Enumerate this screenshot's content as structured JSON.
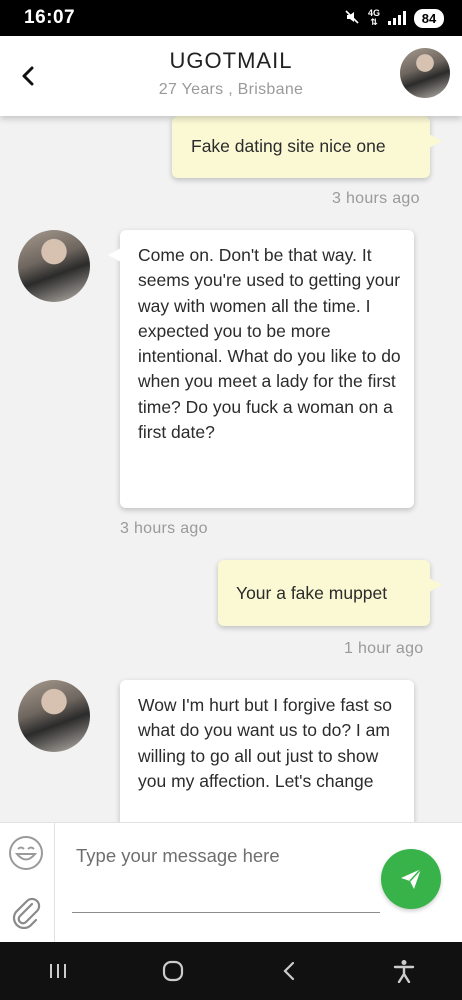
{
  "status_bar": {
    "time": "16:07",
    "network": "4G",
    "battery": "84"
  },
  "header": {
    "title": "UGOTMAIL",
    "subtitle": "27 Years , Brisbane"
  },
  "messages": [
    {
      "direction": "out",
      "text": "Fake dating site nice one",
      "time": "3 hours ago"
    },
    {
      "direction": "in",
      "text": "Come on. Don't be that way. It seems you're used to getting your way with women all the time. I expected you to be more intentional. What do you like to do when you meet a lady for the first time? Do you fuck a woman on a first date?",
      "time": "3 hours ago"
    },
    {
      "direction": "out",
      "text": "Your a fake muppet",
      "time": "1 hour ago"
    },
    {
      "direction": "in",
      "text": "Wow I'm hurt but I forgive fast so what do you want us to do? I am willing to go all out just to show you my affection. Let's change"
    }
  ],
  "composer": {
    "placeholder": "Type your message here"
  },
  "colors": {
    "send_button": "#37b34a",
    "outgoing_bubble": "#fbf9d4",
    "incoming_bubble": "#ffffff"
  },
  "icons": {
    "back": "chevron-left-icon",
    "emoji": "smiley-icon",
    "attach": "paperclip-icon",
    "send": "paper-plane-icon",
    "nav": [
      "recent-apps-icon",
      "home-icon",
      "back-icon",
      "accessibility-icon"
    ]
  }
}
